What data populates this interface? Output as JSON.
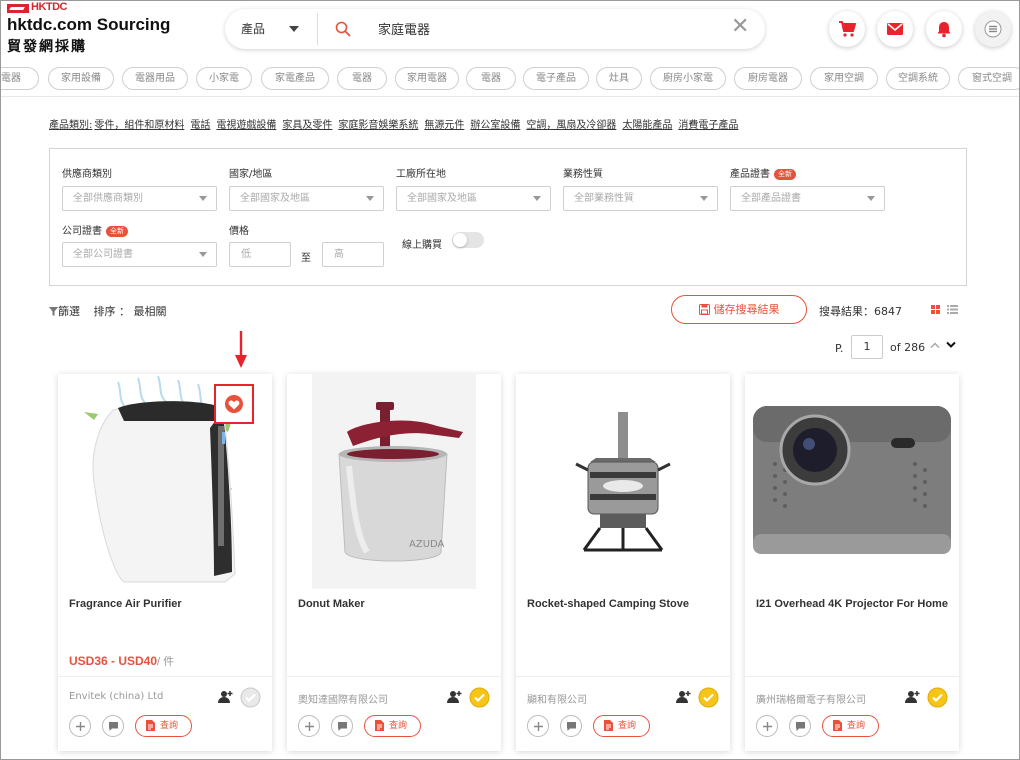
{
  "logo": {
    "brand": "HKTDC",
    "title_en": "hktdc.com Sourcing",
    "title_zh": "貿發網採購"
  },
  "search": {
    "category": "產品",
    "query": "家庭電器",
    "clear_symbol": "✕"
  },
  "header_icons": [
    "cart-icon",
    "mail-icon",
    "bell-icon",
    "menu-icon"
  ],
  "colors": {
    "accent": "#e8523c",
    "highlight": "#e8232b"
  },
  "chips": [
    "電器",
    "家用設備",
    "電器用品",
    "小家電",
    "家電產品",
    "電器",
    "家用電器",
    "電器",
    "電子產品",
    "灶具",
    "廚房小家電",
    "廚房電器",
    "家用空調",
    "空調系統",
    "窗式空調"
  ],
  "categories": {
    "label": "產品類別:",
    "items": [
      "零件，組件和原材料",
      "電話",
      "電視遊戲設備",
      "家具及零件",
      "家庭影音娛樂系統",
      "無源元件",
      "辦公室設備",
      "空調，風扇及冷卻器",
      "太陽能產品",
      "消費電子產品"
    ]
  },
  "filters": {
    "supplier_type": {
      "label": "供應商類別",
      "value": "全部供應商類別"
    },
    "country": {
      "label": "國家/地區",
      "value": "全部國家及地區"
    },
    "factory": {
      "label": "工廠所在地",
      "value": "全部國家及地區"
    },
    "business_type": {
      "label": "業務性質",
      "value": "全部業務性質"
    },
    "product_cert": {
      "label": "產品證書",
      "value": "全部產品證書"
    },
    "company_cert": {
      "label": "公司證書",
      "value": "全部公司證書"
    },
    "price": {
      "label": "價格",
      "low": "低",
      "to": "至",
      "high": "高"
    },
    "online_buy": {
      "label": "線上購買"
    },
    "new_badge": "全新"
  },
  "toolbar": {
    "filter_label": "篩選",
    "sort_label": "排序 ：",
    "sort_value": "最相關",
    "save_label": "儲存搜尋結果",
    "results_label": "搜尋結果：",
    "results_count": "6847"
  },
  "pager": {
    "prefix": "P.",
    "page": "1",
    "total": "of 286"
  },
  "products": [
    {
      "title": "Fragrance Air Purifier",
      "price": "USD36 - USD40",
      "unit": "/ 件",
      "supplier": "Envitek (china) Ltd",
      "inquiry": "查詢",
      "badge": "grey"
    },
    {
      "title": "Donut Maker",
      "price": "",
      "unit": "",
      "supplier": "奧知達國際有限公司",
      "inquiry": "查詢",
      "badge": "gold",
      "watermark": "AZUDA"
    },
    {
      "title": "Rocket-shaped Camping Stove",
      "price": "",
      "unit": "",
      "supplier": "顯和有限公司",
      "inquiry": "查詢",
      "badge": "gold"
    },
    {
      "title": "I21 Overhead 4K Projector For Home",
      "price": "",
      "unit": "",
      "supplier": "廣州瑞格爾電子有限公司",
      "inquiry": "查詢",
      "badge": "gold"
    }
  ]
}
